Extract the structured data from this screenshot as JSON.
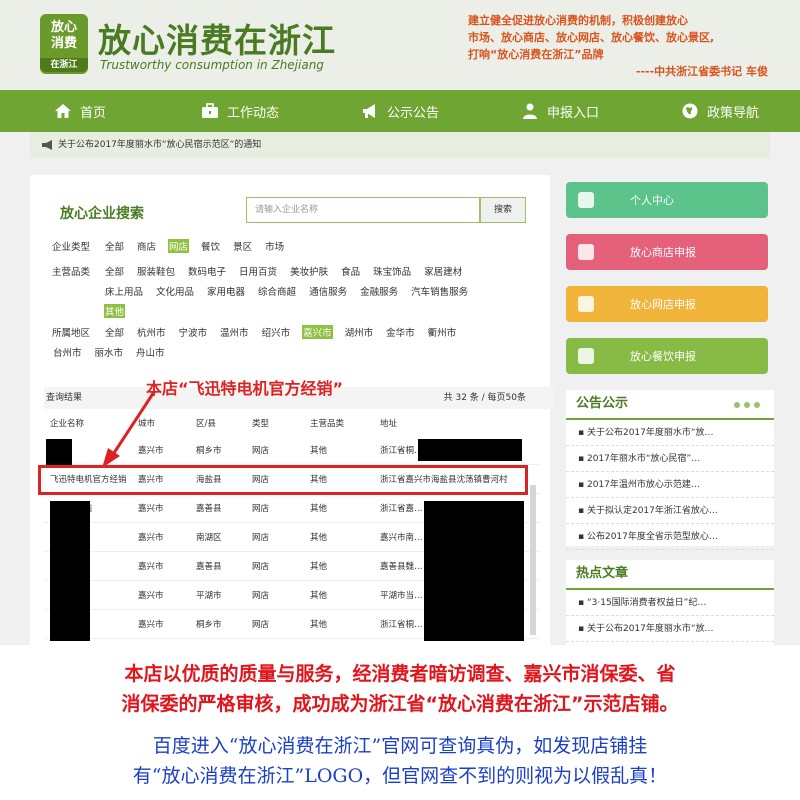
{
  "header": {
    "logo_top": "放心",
    "logo_mid": "消费",
    "logo_sub": "在浙江",
    "title": "放心消费在浙江",
    "subtitle": "Trustworthy consumption in Zhejiang",
    "slogan_1": "建立健全促进放心消费的机制，积极创建放心",
    "slogan_2": "市场、放心商店、放心网店、放心餐饮、放心景区,",
    "slogan_3": "打响“放心消费在浙江”品牌",
    "slogan_sign": "----中共浙江省委书记  车俊"
  },
  "nav": [
    {
      "label": "首页",
      "icon": "home-icon"
    },
    {
      "label": "工作动态",
      "icon": "briefcase-icon"
    },
    {
      "label": "公示公告",
      "icon": "megaphone-icon"
    },
    {
      "label": "申报入口",
      "icon": "user-icon"
    },
    {
      "label": "政策导航",
      "icon": "globe-icon"
    }
  ],
  "notice": "关于公布2017年度丽水市“放心民宿示范区”的通知",
  "search": {
    "title": "放心企业搜索",
    "placeholder": "请输入企业名称",
    "button": "搜索"
  },
  "filters": {
    "type": {
      "label": "企业类型",
      "options": [
        "全部",
        "商店",
        "网店",
        "餐饮",
        "景区",
        "市场"
      ],
      "active": "网店"
    },
    "category": {
      "label": "主营品类",
      "options": [
        "全部",
        "服装鞋包",
        "数码电子",
        "日用百货",
        "美妆护肤",
        "食品",
        "珠宝饰品",
        "家居建材",
        "床上用品",
        "文化用品",
        "家用电器",
        "综合商超",
        "通信服务",
        "金融服务",
        "汽车销售服务",
        "其他"
      ],
      "active": "其他"
    },
    "region": {
      "label": "所属地区",
      "options": [
        "全部",
        "杭州市",
        "宁波市",
        "温州市",
        "绍兴市",
        "嘉兴市",
        "湖州市",
        "金华市",
        "衢州市",
        "台州市",
        "丽水市",
        "舟山市"
      ],
      "active": "嘉兴市"
    }
  },
  "results": {
    "label": "查询结果",
    "count": "共 32 条 / 每页50条",
    "headers": [
      "企业名称",
      "城市",
      "区/县",
      "类型",
      "主营品类",
      "地址"
    ],
    "rows": [
      [
        "…店",
        "嘉兴市",
        "桐乡市",
        "网店",
        "其他",
        "浙江省桐…"
      ],
      [
        "飞迅特电机官方经销",
        "嘉兴市",
        "海盐县",
        "网店",
        "其他",
        "浙江省嘉兴市海盐县沈荡镇曹河村"
      ],
      [
        "…柔旗舰店",
        "嘉兴市",
        "嘉善县",
        "网店",
        "其他",
        "浙江省嘉…"
      ],
      [
        "…生活馆",
        "嘉兴市",
        "南湖区",
        "网店",
        "其他",
        "嘉兴市南…"
      ],
      [
        "…专营店",
        "嘉兴市",
        "嘉善县",
        "网店",
        "其他",
        "嘉善县魏…"
      ],
      [
        "…旗舰店",
        "嘉兴市",
        "平湖市",
        "网店",
        "其他",
        "平湖市当…"
      ],
      [
        "…旗舰",
        "嘉兴市",
        "桐乡市",
        "网店",
        "其他",
        "浙江省桐…"
      ]
    ]
  },
  "annotation": "本店“飞迅特电机官方经销”",
  "side_buttons": [
    {
      "label": "个人中心",
      "color": "#5cc38a"
    },
    {
      "label": "放心商店申报",
      "color": "#e5607a"
    },
    {
      "label": "放心网店申报",
      "color": "#f0b43a"
    },
    {
      "label": "放心餐饮申报",
      "color": "#88bb45"
    }
  ],
  "announcements": {
    "title": "公告公示",
    "items": [
      "关于公布2017年度丽水市“放…",
      "2017年丽水市“放心民宿”…",
      "2017年温州市放心示范建…",
      "关于拟认定2017年浙江省放心…",
      "公布2017年度全省示范型放心…"
    ]
  },
  "hot": {
    "title": "热点文章",
    "items": [
      "“3·15国际消费者权益日”纪…",
      "关于公布2017年度丽水市“放…"
    ]
  },
  "bottom": {
    "line1": "本店以优质的质量与服务，经消费者暗访调查、嘉兴市消保委、省",
    "line2": "消保委的严格审核，成功成为浙江省“放心消费在浙江”示范店铺。",
    "line3": "百度进入“放心消费在浙江”官网可查询真伪，如发现店铺挂",
    "line4": "有“放心消费在浙江”LOGO，但官网查不到的则视为以假乱真！"
  }
}
